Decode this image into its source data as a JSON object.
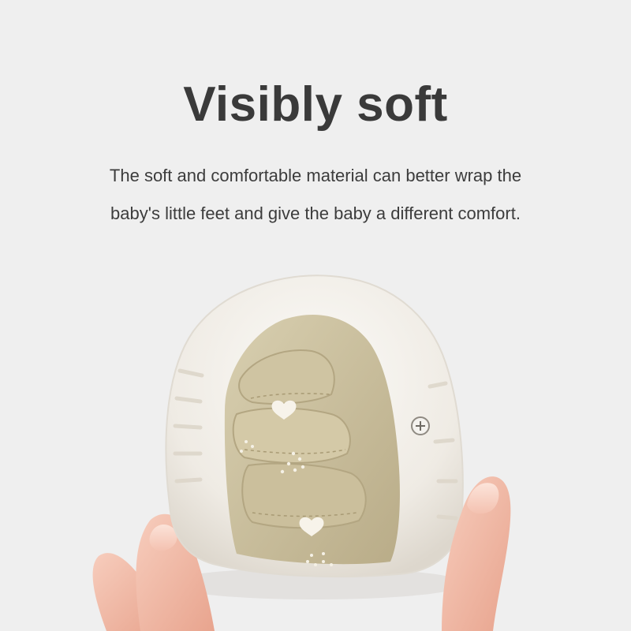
{
  "headline": "Visibly soft",
  "description": {
    "line1": "The soft and comfortable material can better wrap the",
    "line2": "baby's little feet and give the baby a different comfort."
  },
  "colors": {
    "background": "#efefef",
    "text": "#3a3a3a",
    "sole": "#f2efea",
    "fabric": "#cbbf9c",
    "skin": "#f0b49f"
  },
  "image": {
    "subject": "baby-shoe-folded-in-hand"
  }
}
